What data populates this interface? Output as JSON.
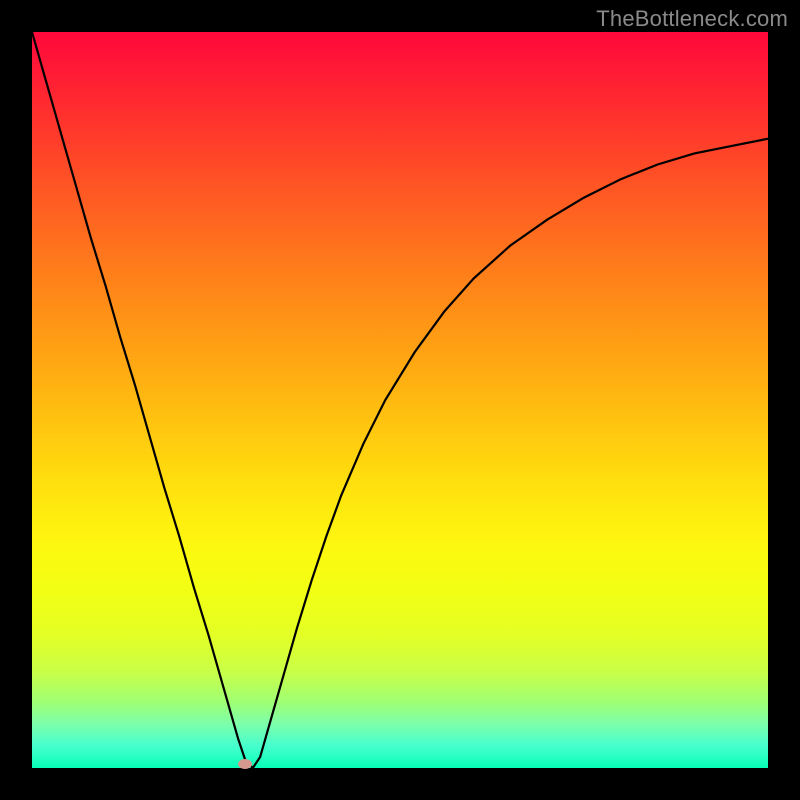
{
  "watermark": "TheBottleneck.com",
  "colors": {
    "frame": "#000000",
    "curve": "#000000",
    "marker": "#d7988f"
  },
  "chart_data": {
    "type": "line",
    "title": "",
    "xlabel": "",
    "ylabel": "",
    "xlim": [
      0,
      100
    ],
    "ylim": [
      0,
      100
    ],
    "x": [
      0,
      2,
      4,
      6,
      8,
      10,
      12,
      14,
      16,
      18,
      20,
      22,
      24,
      26,
      27,
      28,
      29,
      30,
      31,
      32,
      34,
      36,
      38,
      40,
      42,
      45,
      48,
      52,
      56,
      60,
      65,
      70,
      75,
      80,
      85,
      90,
      95,
      100
    ],
    "y": [
      100,
      93,
      86,
      79,
      72,
      65.5,
      58.5,
      52,
      45,
      38,
      31.5,
      24.5,
      18,
      11,
      7.5,
      4,
      1,
      0,
      1.5,
      5,
      12,
      19,
      25.5,
      31.5,
      37,
      44,
      50,
      56.5,
      62,
      66.5,
      71,
      74.5,
      77.5,
      80,
      82,
      83.5,
      84.5,
      85.5
    ],
    "marker": {
      "x": 29,
      "y": 0.5
    },
    "legend": [],
    "grid": false
  }
}
